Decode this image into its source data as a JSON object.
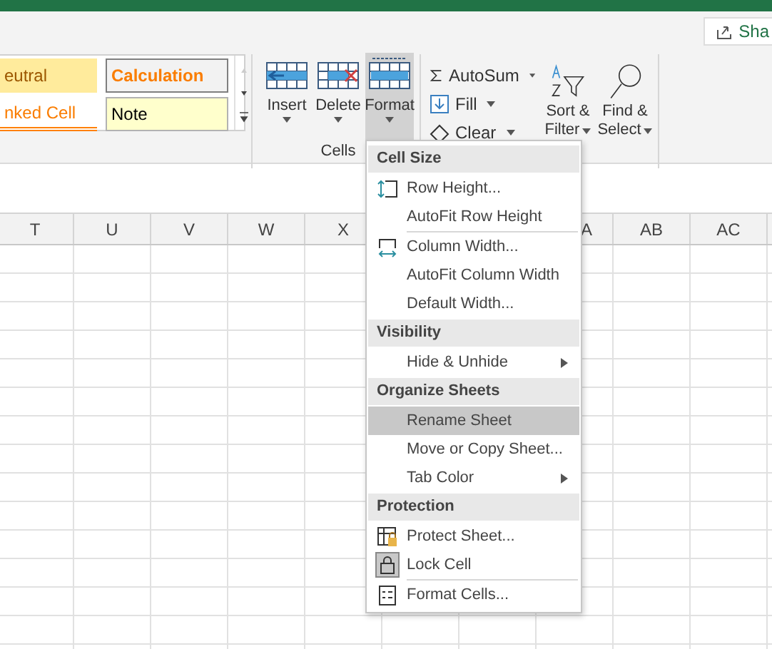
{
  "share_button": {
    "label": "Sha"
  },
  "styles_gallery": [
    {
      "label": "eutral",
      "kind": "neutral"
    },
    {
      "label": "Calculation",
      "kind": "calculation"
    },
    {
      "label": "nked Cell",
      "kind": "linked"
    },
    {
      "label": "Note",
      "kind": "note"
    }
  ],
  "cells_group": {
    "label": "Cells",
    "buttons": [
      {
        "label": "Insert",
        "kind": "insert",
        "selected": false
      },
      {
        "label": "Delete",
        "kind": "delete",
        "selected": false
      },
      {
        "label": "Format",
        "kind": "format",
        "selected": true
      }
    ]
  },
  "editing_group": {
    "small_buttons": [
      {
        "label": "AutoSum",
        "kind": "autosum"
      },
      {
        "label": "Fill",
        "kind": "fill"
      },
      {
        "label": "Clear",
        "kind": "clear"
      }
    ],
    "large_buttons": [
      {
        "label": "Sort &",
        "label_2": "Filter",
        "kind": "sort"
      },
      {
        "label": "Find &",
        "label_2": "Select",
        "kind": "find"
      }
    ]
  },
  "column_headers": [
    {
      "label": "T"
    },
    {
      "label": "U"
    },
    {
      "label": "V"
    },
    {
      "label": "W"
    },
    {
      "label": "X"
    },
    {
      "label": "A",
      "kind": "partial"
    },
    {
      "label": "AB"
    },
    {
      "label": "AC"
    }
  ],
  "format_menu": [
    {
      "kind": "header",
      "label": "Cell Size"
    },
    {
      "kind": "item",
      "label": "Row Height...",
      "submenu": false,
      "selected": false
    },
    {
      "kind": "item",
      "label": "AutoFit Row Height",
      "submenu": false,
      "selected": false
    },
    {
      "kind": "separator"
    },
    {
      "kind": "item",
      "label": "Column Width...",
      "submenu": false,
      "selected": false
    },
    {
      "kind": "item",
      "label": "AutoFit Column Width",
      "submenu": false,
      "selected": false
    },
    {
      "kind": "item",
      "label": "Default Width...",
      "submenu": false,
      "selected": false
    },
    {
      "kind": "header",
      "label": "Visibility"
    },
    {
      "kind": "item",
      "label": "Hide & Unhide",
      "submenu": true,
      "selected": false
    },
    {
      "kind": "header",
      "label": "Organize Sheets"
    },
    {
      "kind": "item",
      "label": "Rename Sheet",
      "submenu": false,
      "selected": true
    },
    {
      "kind": "item",
      "label": "Move or Copy Sheet...",
      "submenu": false,
      "selected": false
    },
    {
      "kind": "item",
      "label": "Tab Color",
      "submenu": true,
      "selected": false
    },
    {
      "kind": "header",
      "label": "Protection"
    },
    {
      "kind": "item",
      "label": "Protect Sheet...",
      "submenu": false,
      "selected": false
    },
    {
      "kind": "item",
      "label": "Lock Cell",
      "checked": true,
      "submenu": false,
      "selected": false
    },
    {
      "kind": "separator"
    },
    {
      "kind": "item",
      "label": "Format Cells...",
      "submenu": false,
      "selected": false
    }
  ]
}
